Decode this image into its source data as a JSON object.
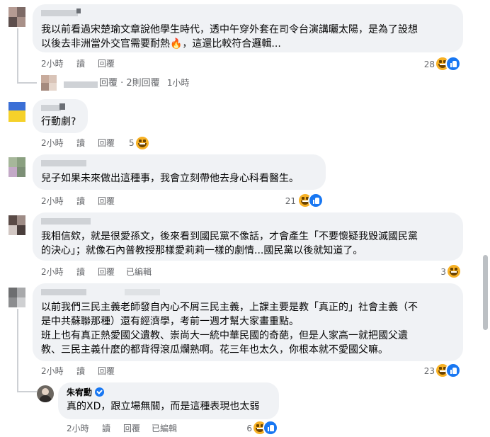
{
  "actions": {
    "read": "讀",
    "reply": "回覆",
    "edited": "已編輯"
  },
  "comments": [
    {
      "text": "我以前看過宋楚瑜文章說他學生時代，透中午穿外套在司令台演講曬太陽，是為了設想\n以後去非洲當外交官需要耐熱🔥，這還比較符合邏輯...",
      "time": "2小時",
      "reactions": "28",
      "reaction_types": [
        "haha-icon",
        "like-icon"
      ]
    },
    {
      "text": "行動劇?",
      "time": "2小時",
      "reactions": "5",
      "reaction_types": [
        "haha-icon"
      ]
    },
    {
      "text": "兒子如果未來做出這種事，我會立刻帶他去身心科看醫生。",
      "time": "2小時",
      "reactions": "21",
      "reaction_types": [
        "haha-icon",
        "like-icon"
      ]
    },
    {
      "text": "我相信欸，就是很愛孫文，後來看到國民黨不像話，才會產生「不要懷疑我毀滅國民黨\n的決心」；就像石內普教授那樣愛莉莉一樣的劇情...國民黨以後就知道了。",
      "time": "2小時",
      "edited": true,
      "reactions": "3",
      "reaction_types": [
        "haha-icon"
      ]
    },
    {
      "text": "以前我們三民主義老師發自內心不屑三民主義，上課主要是教「真正的」社會主義（不\n是中共蘇聯那種）還有經濟學，考前一週才幫大家畫重點。\n班上也有真正熱愛國父遺教、崇尚大一統中華民國的奇葩，但是人家高一就把國父遺\n教、三民主義什麼的都背得滾瓜爛熟啊。花三年也太久，你根本就不愛國父嘛。",
      "time": "2小時",
      "reactions": "23",
      "reaction_types": [
        "haha-icon",
        "like-icon"
      ]
    }
  ],
  "reply_summary": {
    "text": "回覆 · 2則回覆",
    "time": "1小時"
  },
  "nested_reply": {
    "author": "朱宥勳",
    "verified": true,
    "text": "真的XD，跟立場無關，而是這種表現也太弱",
    "time": "2小時",
    "edited": true,
    "reactions": "6",
    "reaction_types": [
      "haha-icon",
      "like-icon"
    ]
  },
  "colors": {
    "bubble": "#f0f2f5",
    "meta": "#65676b",
    "like": "#1877f2",
    "haha": "#f7b125"
  }
}
